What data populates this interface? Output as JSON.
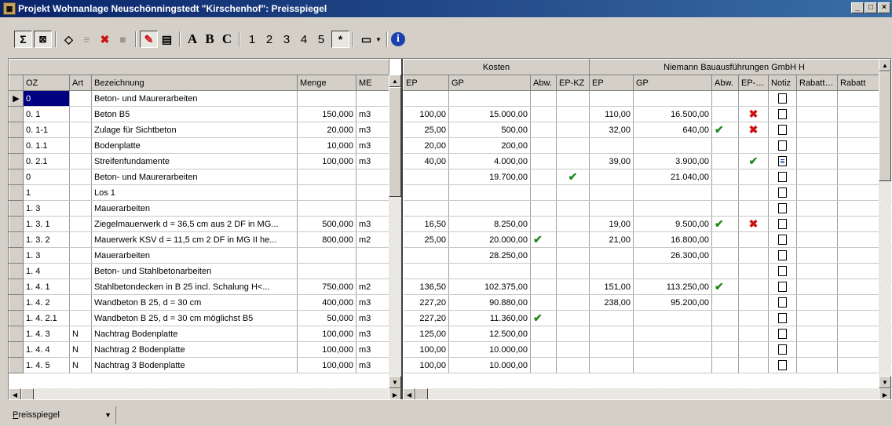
{
  "window": {
    "title": "Projekt Wohnanlage Neuschönningstedt \"Kirschenhof\": Preisspiegel",
    "controls": [
      "_",
      "□",
      "×"
    ]
  },
  "toolbar": {
    "letters": [
      "A",
      "B",
      "C"
    ],
    "numbers": [
      "1",
      "2",
      "3",
      "4",
      "5"
    ],
    "star": "*"
  },
  "groups": {
    "kosten": "Kosten",
    "bidder": "Niemann Bauausführungen GmbH H"
  },
  "columns": {
    "oz": "OZ",
    "art": "Art",
    "bez": "Bezeichnung",
    "menge": "Menge",
    "me": "ME",
    "ep": "EP",
    "gp": "GP",
    "abw": "Abw.",
    "epkz": "EP-KZ",
    "ep2": "EP",
    "gp2": "GP",
    "abw2": "Abw.",
    "epkz2": "EP-KZ",
    "notiz": "Notiz",
    "rabatt1": "Rabatt %",
    "rabatt2": "Rabatt"
  },
  "rows": [
    {
      "oz": "0",
      "art": "",
      "bez": "Beton- und Maurerarbeiten",
      "menge": "",
      "me": "",
      "ep": "",
      "gp": "",
      "abw": "",
      "epkz": "",
      "ep2": "",
      "gp2": "",
      "abw2": "",
      "epkz2": "",
      "notiz": "empty",
      "selected": true
    },
    {
      "oz": "0. 1",
      "art": "",
      "bez": "Beton B5",
      "menge": "150,000",
      "me": "m3",
      "ep": "100,00",
      "gp": "15.000,00",
      "abw": "",
      "epkz": "",
      "ep2": "110,00",
      "gp2": "16.500,00",
      "abw2": "",
      "epkz2": "x",
      "notiz": "empty"
    },
    {
      "oz": "0. 1-1",
      "art": "",
      "bez": "Zulage für Sichtbeton",
      "menge": "20,000",
      "me": "m3",
      "ep": "25,00",
      "gp": "500,00",
      "abw": "",
      "epkz": "",
      "ep2": "32,00",
      "gp2": "640,00",
      "abw2": "check",
      "epkz2": "x",
      "notiz": "empty"
    },
    {
      "oz": "0. 1.1",
      "art": "",
      "bez": "Bodenplatte",
      "menge": "10,000",
      "me": "m3",
      "ep": "20,00",
      "gp": "200,00",
      "abw": "",
      "epkz": "",
      "ep2": "",
      "gp2": "",
      "abw2": "",
      "epkz2": "",
      "notiz": "empty"
    },
    {
      "oz": "0. 2.1",
      "art": "",
      "bez": "Streifenfundamente",
      "menge": "100,000",
      "me": "m3",
      "ep": "40,00",
      "gp": "4.000,00",
      "abw": "",
      "epkz": "",
      "ep2": "39,00",
      "gp2": "3.900,00",
      "abw2": "",
      "epkz2": "check",
      "notiz": "filled"
    },
    {
      "oz": "0",
      "art": "",
      "bez": "Beton- und Maurerarbeiten",
      "menge": "",
      "me": "",
      "ep": "",
      "gp": "19.700,00",
      "abw": "",
      "epkz": "check",
      "ep2": "",
      "gp2": "21.040,00",
      "abw2": "",
      "epkz2": "",
      "notiz": "empty"
    },
    {
      "oz": "1",
      "art": "",
      "bez": "Los 1",
      "menge": "",
      "me": "",
      "ep": "",
      "gp": "",
      "abw": "",
      "epkz": "",
      "ep2": "",
      "gp2": "",
      "abw2": "",
      "epkz2": "",
      "notiz": "empty"
    },
    {
      "oz": "1. 3",
      "art": "",
      "bez": "Mauerarbeiten",
      "menge": "",
      "me": "",
      "ep": "",
      "gp": "",
      "abw": "",
      "epkz": "",
      "ep2": "",
      "gp2": "",
      "abw2": "",
      "epkz2": "",
      "notiz": "empty"
    },
    {
      "oz": "1. 3. 1",
      "art": "",
      "bez": "Ziegelmauerwerk d = 36,5 cm aus 2 DF in MG...",
      "menge": "500,000",
      "me": "m3",
      "ep": "16,50",
      "gp": "8.250,00",
      "abw": "",
      "epkz": "",
      "ep2": "19,00",
      "gp2": "9.500,00",
      "abw2": "check",
      "epkz2": "x",
      "notiz": "empty"
    },
    {
      "oz": "1. 3. 2",
      "art": "",
      "bez": "Mauerwerk KSV d = 11,5 cm 2 DF in MG II he...",
      "menge": "800,000",
      "me": "m2",
      "ep": "25,00",
      "gp": "20.000,00",
      "abw": "check",
      "epkz": "",
      "ep2": "21,00",
      "gp2": "16.800,00",
      "abw2": "",
      "epkz2": "",
      "notiz": "empty"
    },
    {
      "oz": "1. 3",
      "art": "",
      "bez": "Mauerarbeiten",
      "menge": "",
      "me": "",
      "ep": "",
      "gp": "28.250,00",
      "abw": "",
      "epkz": "",
      "ep2": "",
      "gp2": "26.300,00",
      "abw2": "",
      "epkz2": "",
      "notiz": "empty"
    },
    {
      "oz": "1. 4",
      "art": "",
      "bez": "Beton- und Stahlbetonarbeiten",
      "menge": "",
      "me": "",
      "ep": "",
      "gp": "",
      "abw": "",
      "epkz": "",
      "ep2": "",
      "gp2": "",
      "abw2": "",
      "epkz2": "",
      "notiz": "empty"
    },
    {
      "oz": "1. 4. 1",
      "art": "",
      "bez": "Stahlbetondecken in B 25 incl. Schalung  H<...",
      "menge": "750,000",
      "me": "m2",
      "ep": "136,50",
      "gp": "102.375,00",
      "abw": "",
      "epkz": "",
      "ep2": "151,00",
      "gp2": "113.250,00",
      "abw2": "check",
      "epkz2": "",
      "notiz": "empty"
    },
    {
      "oz": "1. 4. 2",
      "art": "",
      "bez": "Wandbeton B 25, d = 30 cm",
      "menge": "400,000",
      "me": "m3",
      "ep": "227,20",
      "gp": "90.880,00",
      "abw": "",
      "epkz": "",
      "ep2": "238,00",
      "gp2": "95.200,00",
      "abw2": "",
      "epkz2": "",
      "notiz": "empty"
    },
    {
      "oz": "1. 4. 2.1",
      "art": "",
      "bez": "Wandbeton B 25, d = 30 cm möglichst B5",
      "menge": "50,000",
      "me": "m3",
      "ep": "227,20",
      "gp": "11.360,00",
      "abw": "check",
      "epkz": "",
      "ep2": "",
      "gp2": "",
      "abw2": "",
      "epkz2": "",
      "notiz": "empty"
    },
    {
      "oz": "1. 4. 3",
      "art": "N",
      "bez": "Nachtrag Bodenplatte",
      "menge": "100,000",
      "me": "m3",
      "ep": "125,00",
      "gp": "12.500,00",
      "abw": "",
      "epkz": "",
      "ep2": "",
      "gp2": "",
      "abw2": "",
      "epkz2": "",
      "notiz": "empty"
    },
    {
      "oz": "1. 4. 4",
      "art": "N",
      "bez": "Nachtrag 2 Bodenplatte",
      "menge": "100,000",
      "me": "m3",
      "ep": "100,00",
      "gp": "10.000,00",
      "abw": "",
      "epkz": "",
      "ep2": "",
      "gp2": "",
      "abw2": "",
      "epkz2": "",
      "notiz": "empty"
    },
    {
      "oz": "1. 4. 5",
      "art": "N",
      "bez": "Nachtrag 3 Bodenplatte",
      "menge": "100,000",
      "me": "m3",
      "ep": "100,00",
      "gp": "10.000,00",
      "abw": "",
      "epkz": "",
      "ep2": "",
      "gp2": "",
      "abw2": "",
      "epkz2": "",
      "notiz": "empty"
    }
  ],
  "statusbar": {
    "view_underlined": "P",
    "view_rest": "reisspiegel"
  },
  "colors": {
    "title_start": "#0a246a",
    "title_end": "#3a6ea5",
    "selection": "#000080",
    "check": "#1d8a1d",
    "cross": "#cc1111",
    "face": "#d4d0c8"
  }
}
